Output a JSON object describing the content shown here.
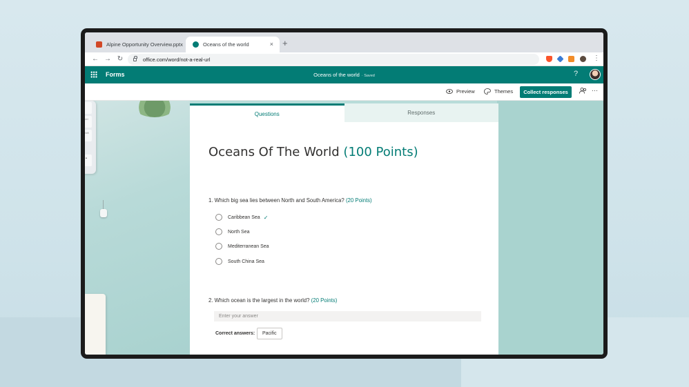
{
  "browser": {
    "tabs": [
      {
        "label": "Alpine Opportunity Overview.pptx",
        "icon": "powerpoint-icon",
        "active": false
      },
      {
        "label": "Oceans of the world",
        "icon": "forms-icon",
        "active": true
      }
    ],
    "new_tab_glyph": "+",
    "close_glyph": "×",
    "url": "office.com/word/not-a-real-url",
    "nav": {
      "back": "←",
      "forward": "→",
      "reload": "↻"
    },
    "menu_glyph": "⋮"
  },
  "forms_header": {
    "app_name": "Forms",
    "doc_title": "Oceans of the world",
    "saved_label": "· Saved",
    "help_glyph": "?"
  },
  "command_bar": {
    "preview_label": "Preview",
    "themes_label": "Themes",
    "collect_label": "Collect responses",
    "more_glyph": "···",
    "accent_color": "#037c75"
  },
  "form": {
    "tabs": {
      "questions": "Questions",
      "responses": "Responses"
    },
    "title": "Oceans Of The World",
    "title_points": "(100 Points)",
    "q1": {
      "text": "1. Which big sea lies between North and South America?",
      "points": "(20 Points)",
      "options": [
        "Caribbean Sea",
        "North Sea",
        "Mediterranean Sea",
        "South China Sea"
      ],
      "correct_mark": "✓"
    },
    "q2": {
      "text": "2. Which ocean is the largest in the world?",
      "points": "(20 Points)",
      "placeholder": "Enter your answer",
      "correct_label": "Correct answers:",
      "correct_value": "Pacific"
    }
  },
  "decor": {
    "keys": [
      "",
      "ctrl",
      "shift",
      "▲"
    ]
  }
}
